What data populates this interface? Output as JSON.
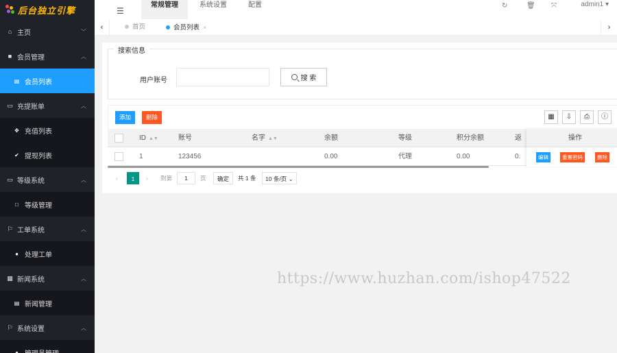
{
  "logo": {
    "text": "后台独立引擎"
  },
  "sidebar": {
    "groups": [
      {
        "label": "主页",
        "icon": "home-icon"
      },
      {
        "label": "会员管理",
        "icon": "user-square-icon",
        "items": [
          {
            "label": "会员列表",
            "icon": "list-icon",
            "active": true
          }
        ]
      },
      {
        "label": "充提账单",
        "icon": "card-icon",
        "items": [
          {
            "label": "充值列表",
            "icon": "share-icon"
          },
          {
            "label": "提现列表",
            "icon": "check-circle-icon"
          }
        ]
      },
      {
        "label": "等级系统",
        "icon": "monitor-icon",
        "items": [
          {
            "label": "等级管理",
            "icon": "square-icon"
          }
        ]
      },
      {
        "label": "工单系统",
        "icon": "flag-icon",
        "items": [
          {
            "label": "处理工单",
            "icon": "gear-circle-icon"
          }
        ]
      },
      {
        "label": "新闻系统",
        "icon": "keyboard-icon",
        "items": [
          {
            "label": "新闻管理",
            "icon": "news-icon"
          }
        ]
      },
      {
        "label": "系统设置",
        "icon": "flag-icon",
        "items": [
          {
            "label": "管理员管理",
            "icon": "gear-circle-icon"
          }
        ]
      }
    ]
  },
  "header": {
    "tabs": [
      {
        "label": "常规管理",
        "active": true
      },
      {
        "label": "系统设置"
      },
      {
        "label": "配置"
      }
    ],
    "user": "admin1"
  },
  "pagetabs": {
    "home": "首页",
    "current": "会员列表"
  },
  "search": {
    "legend": "搜索信息",
    "account_label": "用户账号",
    "account_value": "",
    "button": "搜 索"
  },
  "toolbar": {
    "add": "添加",
    "delete": "删除"
  },
  "table": {
    "columns": {
      "id": "ID",
      "account": "账号",
      "name": "名字",
      "balance": "余额",
      "level": "等级",
      "points": "积分余额",
      "cut": "返",
      "ops": "操作"
    },
    "rows": [
      {
        "id": "1",
        "account": "123456",
        "name": "",
        "balance": "0.00",
        "level": "代理",
        "points": "0.00",
        "cut": "0."
      }
    ],
    "ops": {
      "edit": "编辑",
      "reset": "重置密码",
      "delete": "删除"
    }
  },
  "pager": {
    "current": "1",
    "goto_label": "到第",
    "page_input": "1",
    "page_unit": "页",
    "confirm": "确定",
    "total": "共 1 条",
    "per_page": "10 条/页"
  },
  "watermark": "https://www.huzhan.com/ishop47522",
  "colors": {
    "sidebar_bg": "#20222a",
    "active": "#1e9fff",
    "danger": "#ff5722",
    "pager_current": "#009688",
    "logo": "#ffb800"
  }
}
